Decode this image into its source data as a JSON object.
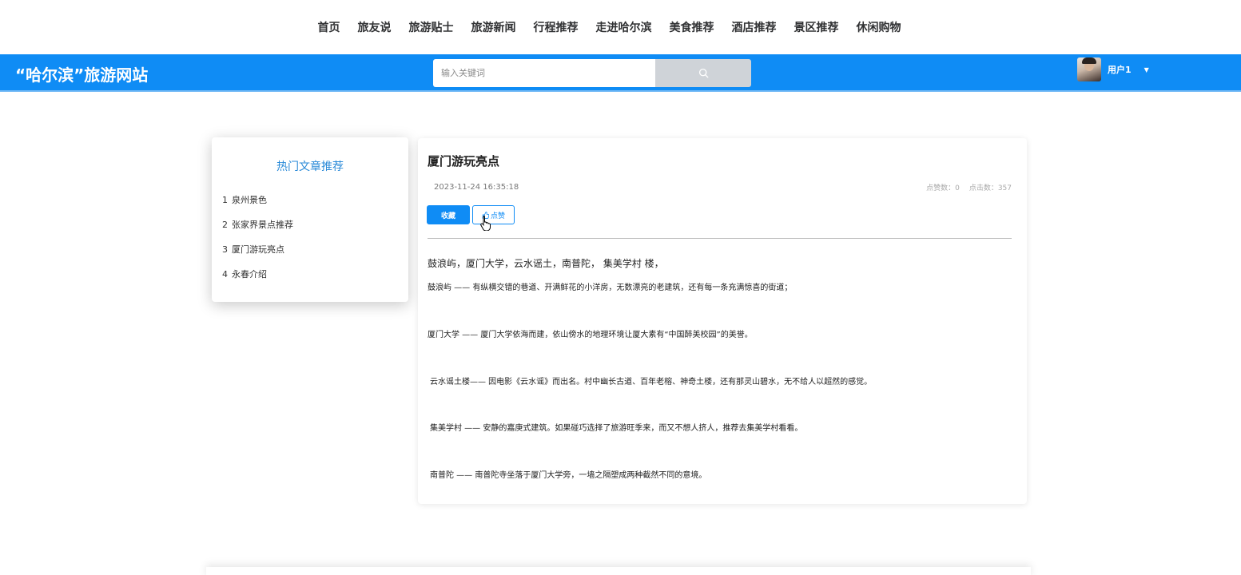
{
  "nav": {
    "items": [
      "首页",
      "旅友说",
      "旅游贴士",
      "旅游新闻",
      "行程推荐",
      "走进哈尔滨",
      "美食推荐",
      "酒店推荐",
      "景区推荐",
      "休闲购物"
    ]
  },
  "header": {
    "logo": "“哈尔滨”旅游网站",
    "search_placeholder": "输入关键词",
    "user_name": "用户1"
  },
  "sidebar": {
    "title": "热门文章推荐",
    "items": [
      {
        "num": "1",
        "label": "泉州景色"
      },
      {
        "num": "2",
        "label": "张家界景点推荐"
      },
      {
        "num": "3",
        "label": "厦门游玩亮点"
      },
      {
        "num": "4",
        "label": "永春介绍"
      }
    ]
  },
  "article": {
    "title": "厦门游玩亮点",
    "date": "2023-11-24 16:35:18",
    "likes": "点赞数：0",
    "clicks": "点击数：357",
    "fav_label": "收藏",
    "like_label": "点赞",
    "lead": "鼓浪屿，厦门大学，云水谣土，南普陀，  集美学村 楼，",
    "paragraphs": [
      "鼓浪屿 —— 有纵横交错的巷道、开满鲜花的小洋房，无数漂亮的老建筑，还有每一条充满惊喜的街道；",
      "厦门大学 —— 厦门大学依海而建，依山傍水的地理环境让厦大素有“中国醉美校园”的美誉。",
      "云水谣土楼—— 因电影《云水谣》而出名。村中幽长古道、百年老榕、神奇土楼，还有那灵山碧水，无不给人以超然的感觉。",
      "集美学村 —— 安静的嘉庚式建筑。如果碰巧选择了旅游旺季来，而又不想人挤人，推荐去集美学村看看。",
      "南普陀 —— 南普陀寺坐落于厦门大学旁，一墙之隔塑成两种截然不同的意境。"
    ]
  },
  "colors": {
    "primary": "#0f8cf5",
    "sidebar_title": "#2a8ad8"
  }
}
